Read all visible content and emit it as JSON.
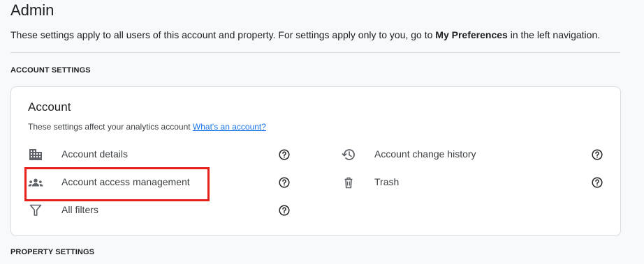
{
  "page": {
    "title": "Admin",
    "intro_before": "These settings apply to all users of this account and property. For settings apply only to you, go to ",
    "intro_bold": "My Preferences",
    "intro_after": " in the left navigation."
  },
  "sections": {
    "account_heading": "ACCOUNT SETTINGS",
    "property_heading": "PROPERTY SETTINGS"
  },
  "account_card": {
    "title": "Account",
    "description": "These settings affect your analytics account ",
    "link": "What's an account?",
    "items": [
      {
        "label": "Account details",
        "icon": "building-icon"
      },
      {
        "label": "Account access management",
        "icon": "people-icon"
      },
      {
        "label": "All filters",
        "icon": "filter-icon"
      },
      {
        "label": "Account change history",
        "icon": "history-icon"
      },
      {
        "label": "Trash",
        "icon": "trash-icon"
      }
    ],
    "help_icon": "help-circle-icon"
  },
  "colors": {
    "background": "#f8f9fa",
    "card": "#ffffff",
    "link": "#1a73e8",
    "highlight": "#e8201a"
  }
}
